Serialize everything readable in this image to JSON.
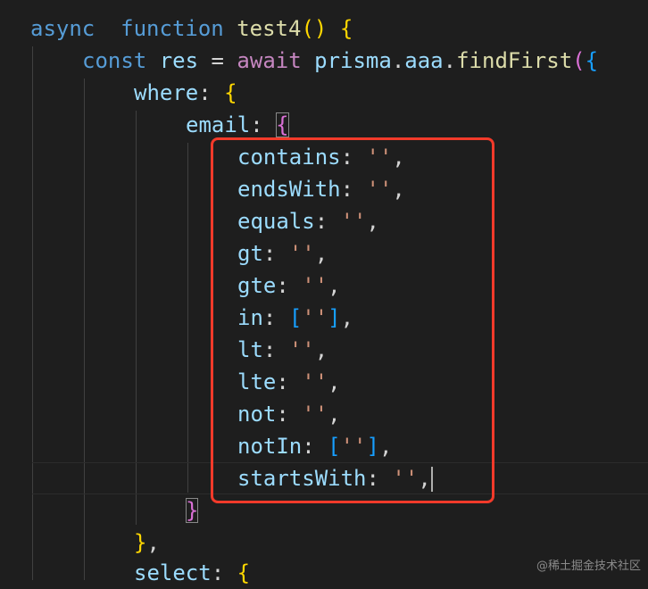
{
  "code": {
    "line1": {
      "async": "async",
      "function": "function",
      "name": "test4",
      "parens": "()",
      "brace": "{"
    },
    "line2": {
      "const": "const",
      "var": "res",
      "eq": "=",
      "await": "await",
      "obj": "prisma",
      "dot1": ".",
      "model": "aaa",
      "dot2": ".",
      "method": "findFirst",
      "paren": "(",
      "brace": "{"
    },
    "line3": {
      "key": "where",
      "colon": ":",
      "brace": "{"
    },
    "line4": {
      "key": "email",
      "colon": ":",
      "brace": "{"
    },
    "props": [
      {
        "key": "contains",
        "sep": ": ",
        "value": "''",
        "end": ","
      },
      {
        "key": "endsWith",
        "sep": ": ",
        "value": "''",
        "end": ","
      },
      {
        "key": "equals",
        "sep": ": ",
        "value": "''",
        "end": ","
      },
      {
        "key": "gt",
        "sep": ": ",
        "value": "''",
        "end": ","
      },
      {
        "key": "gte",
        "sep": ": ",
        "value": "''",
        "end": ","
      },
      {
        "key": "in",
        "sep": ": ",
        "open": "[",
        "value": "''",
        "close": "]",
        "end": ","
      },
      {
        "key": "lt",
        "sep": ": ",
        "value": "''",
        "end": ","
      },
      {
        "key": "lte",
        "sep": ": ",
        "value": "''",
        "end": ","
      },
      {
        "key": "not",
        "sep": ": ",
        "value": "''",
        "end": ","
      },
      {
        "key": "notIn",
        "sep": ": ",
        "open": "[",
        "value": "''",
        "close": "]",
        "end": ","
      },
      {
        "key": "startsWith",
        "sep": ": ",
        "value": "''",
        "end": ","
      }
    ],
    "close_email": "}",
    "close_where": {
      "brace": "}",
      "comma": ","
    },
    "select_line": {
      "key": "select",
      "colon": ":",
      "brace": "{"
    }
  },
  "watermark": "@稀土掘金技术社区",
  "colors": {
    "background": "#1e1e1e",
    "keyword": "#569cd6",
    "control": "#c586c0",
    "function": "#dcdcaa",
    "variable": "#9cdcfe",
    "string": "#ce9178",
    "bracket_gold": "#ffd700",
    "bracket_orchid": "#da70d6",
    "bracket_blue": "#179fff",
    "highlight_box": "#f23a2a"
  }
}
